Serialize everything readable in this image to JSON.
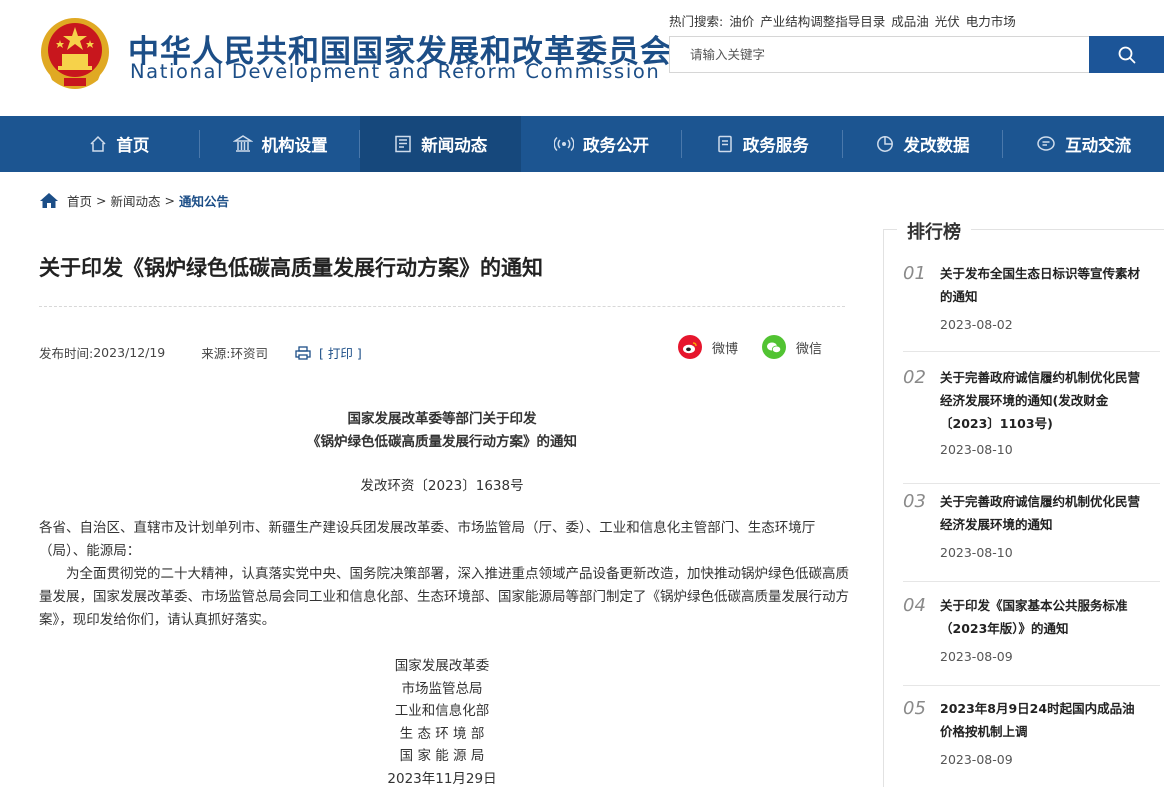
{
  "header": {
    "title_cn": "中华人民共和国国家发展和改革委员会",
    "title_en": "National Development and Reform Commission",
    "hot_label": "热门搜索:",
    "hot_terms": [
      "油价",
      "产业结构调整指导目录",
      "成品油",
      "光伏",
      "电力市场"
    ],
    "search_placeholder": "请输入关键字"
  },
  "colors": {
    "brand": "#1c5591",
    "nav_active": "#16487c",
    "weibo": "#e6162d",
    "wechat": "#51c332"
  },
  "nav": {
    "items": [
      {
        "label": "首页",
        "icon": "home-icon"
      },
      {
        "label": "机构设置",
        "icon": "building-icon"
      },
      {
        "label": "新闻动态",
        "icon": "news-icon"
      },
      {
        "label": "政务公开",
        "icon": "broadcast-icon"
      },
      {
        "label": "政务服务",
        "icon": "document-icon"
      },
      {
        "label": "发改数据",
        "icon": "pie-chart-icon"
      },
      {
        "label": "互动交流",
        "icon": "chat-icon"
      }
    ],
    "active_index": 2
  },
  "breadcrumb": {
    "home": "首页",
    "sep": ">",
    "level1": "新闻动态",
    "current": "通知公告"
  },
  "article": {
    "title": "关于印发《锅炉绿色低碳高质量发展行动方案》的通知",
    "publish_label": "发布时间:",
    "publish_date": "2023/12/19",
    "source_label": "来源:",
    "source": "环资司",
    "print_label": "[ 打印 ]",
    "share_weibo": "微博",
    "share_wechat": "微信",
    "heading_line1": "国家发展改革委等部门关于印发",
    "heading_line2": "《锅炉绿色低碳高质量发展行动方案》的通知",
    "doc_number": "发改环资〔2023〕1638号",
    "addressee": "各省、自治区、直辖市及计划单列市、新疆生产建设兵团发展改革委、市场监管局（厅、委）、工业和信息化主管部门、生态环境厅（局）、能源局：",
    "body": "为全面贯彻党的二十大精神，认真落实党中央、国务院决策部署，深入推进重点领域产品设备更新改造，加快推动锅炉绿色低碳高质量发展，国家发展改革委、市场监管总局会同工业和信息化部、生态环境部、国家能源局等部门制定了《锅炉绿色低碳高质量发展行动方案》，现印发给你们，请认真抓好落实。",
    "signatories": [
      "国家发展改革委",
      "市场监管总局",
      "工业和信息化部",
      "生 态 环 境 部",
      "国 家 能 源 局"
    ],
    "sign_date": "2023年11月29日"
  },
  "ranking": {
    "title": "排行榜",
    "items": [
      {
        "num": "01",
        "text": "关于发布全国生态日标识等宣传素材的通知",
        "date": "2023-08-02"
      },
      {
        "num": "02",
        "text": "关于完善政府诚信履约机制优化民营经济发展环境的通知(发改财金〔2023〕1103号)",
        "date": "2023-08-10"
      },
      {
        "num": "03",
        "text": "关于完善政府诚信履约机制优化民营经济发展环境的通知",
        "date": "2023-08-10"
      },
      {
        "num": "04",
        "text": "关于印发《国家基本公共服务标准（2023年版）》的通知",
        "date": "2023-08-09"
      },
      {
        "num": "05",
        "text": "2023年8月9日24时起国内成品油价格按机制上调",
        "date": "2023-08-09"
      }
    ]
  }
}
